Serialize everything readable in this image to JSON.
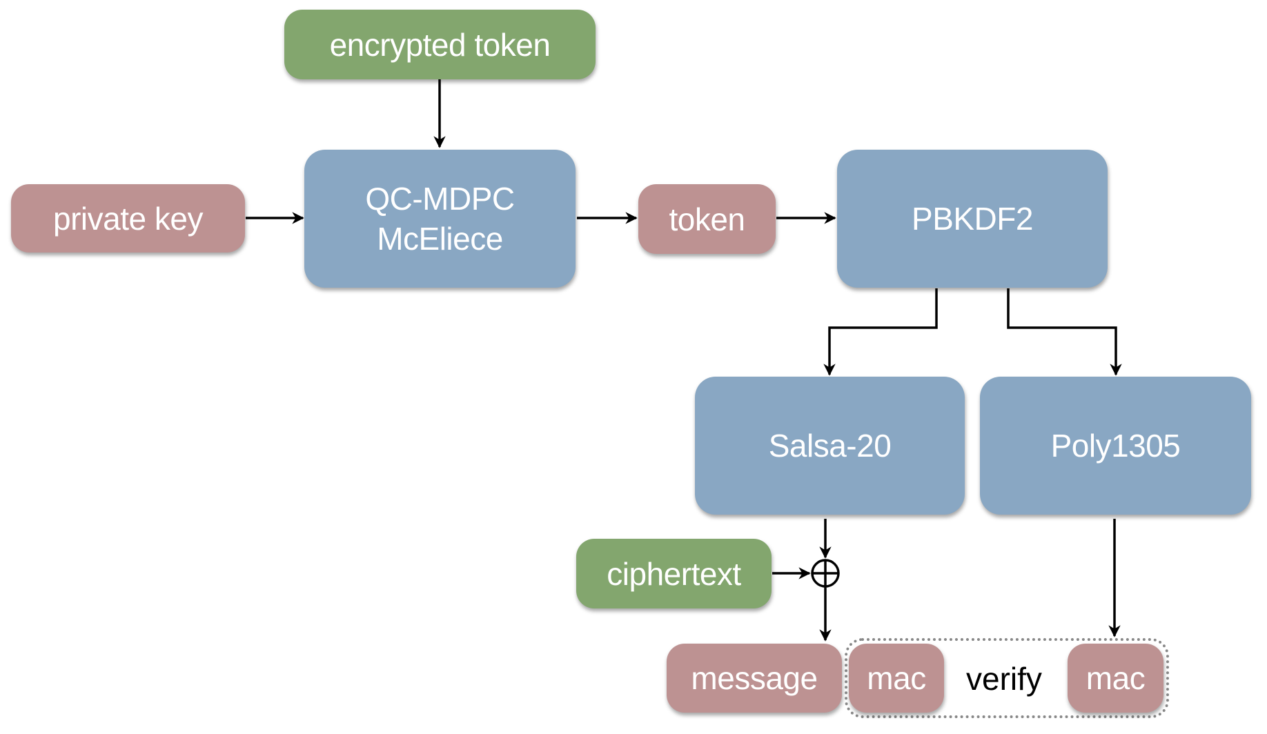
{
  "diagram": {
    "nodes": {
      "encrypted_token": "encrypted token",
      "private_key": "private key",
      "qc_mdpc_line1": "QC-MDPC",
      "qc_mdpc_line2": "McEliece",
      "token": "token",
      "pbkdf2": "PBKDF2",
      "salsa20": "Salsa-20",
      "poly1305": "Poly1305",
      "ciphertext": "ciphertext",
      "message": "message",
      "mac_left": "mac",
      "mac_right": "mac",
      "verify": "verify"
    },
    "xor_symbol": "⊕",
    "edges": [
      {
        "from": "encrypted token",
        "to": "QC-MDPC McEliece"
      },
      {
        "from": "private key",
        "to": "QC-MDPC McEliece"
      },
      {
        "from": "QC-MDPC McEliece",
        "to": "token"
      },
      {
        "from": "token",
        "to": "PBKDF2"
      },
      {
        "from": "PBKDF2",
        "to": "Salsa-20"
      },
      {
        "from": "PBKDF2",
        "to": "Poly1305"
      },
      {
        "from": "Salsa-20",
        "to": "xor"
      },
      {
        "from": "ciphertext",
        "to": "xor"
      },
      {
        "from": "xor",
        "to": "message"
      },
      {
        "from": "Poly1305",
        "to": "mac"
      }
    ],
    "colors": {
      "input": "#83a66e",
      "intermediate": "#bd9292",
      "process": "#89a7c3"
    }
  }
}
